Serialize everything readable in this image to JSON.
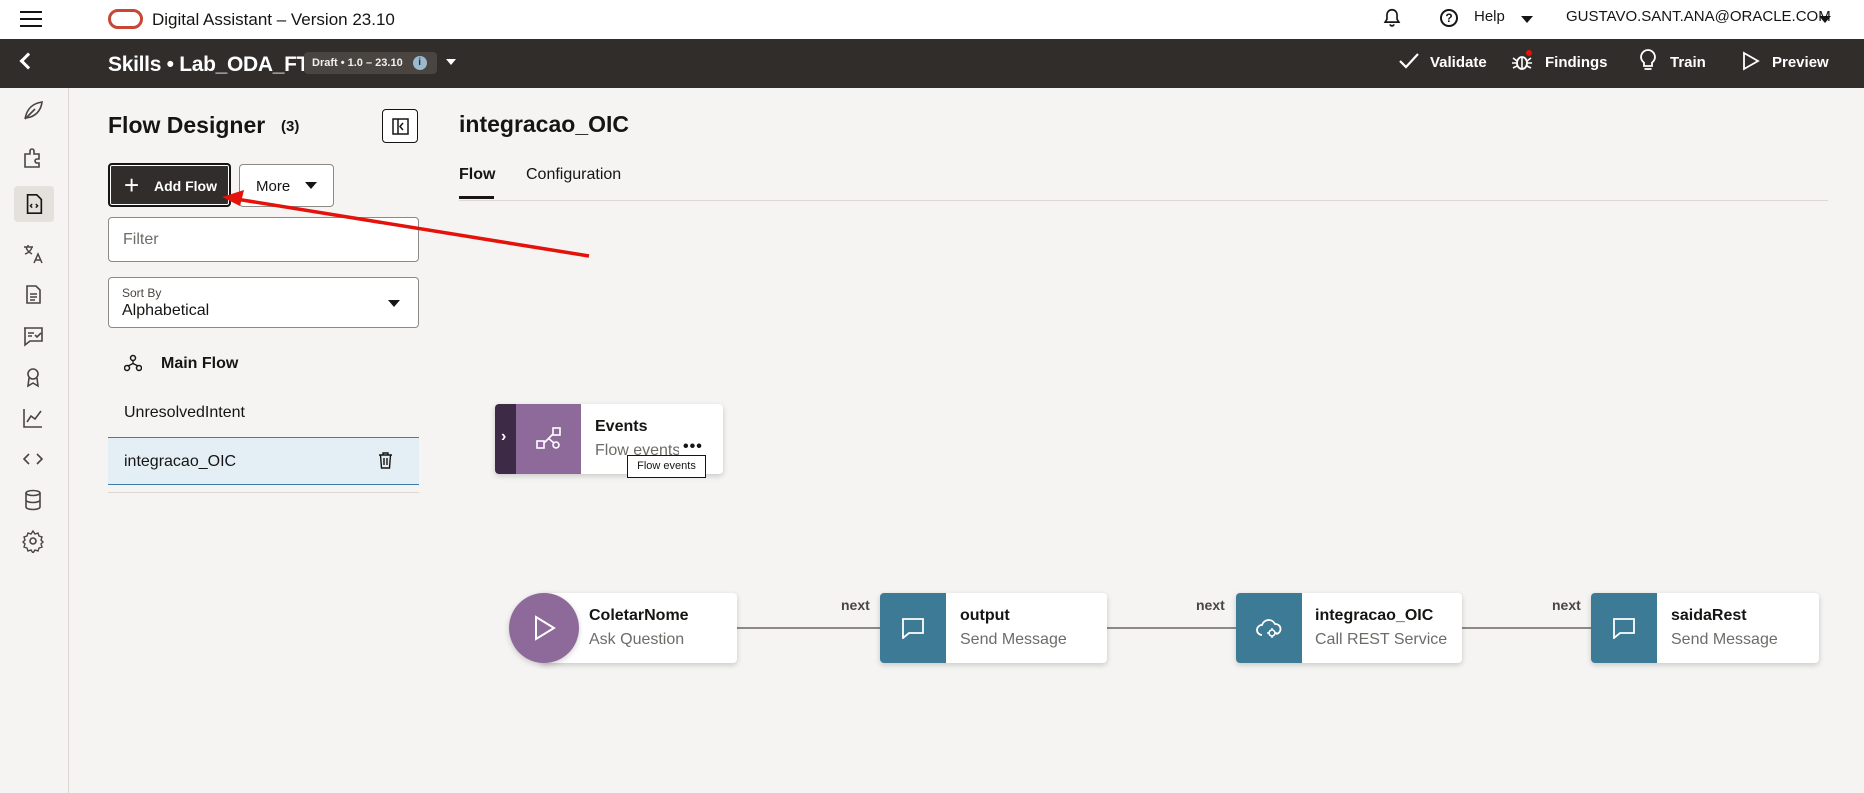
{
  "header": {
    "app_title": "Digital Assistant – Version 23.10",
    "help_label": "Help",
    "user": "GUSTAVO.SANT.ANA@ORACLE.COM"
  },
  "skillbar": {
    "title": "Skills • Lab_ODA_FT",
    "badge": "Draft • 1.0 – 23.10",
    "actions": {
      "validate": "Validate",
      "findings": "Findings",
      "train": "Train",
      "preview": "Preview"
    }
  },
  "panel": {
    "title": "Flow Designer",
    "count": "(3)",
    "add_flow": "Add Flow",
    "more": "More",
    "filter_placeholder": "Filter",
    "sort_label": "Sort By",
    "sort_value": "Alphabetical",
    "flows": [
      "Main Flow",
      "UnresolvedIntent",
      "integracao_OIC"
    ]
  },
  "main": {
    "title": "integracao_OIC",
    "tabs": [
      "Flow",
      "Configuration"
    ],
    "events_node": {
      "title": "Events",
      "sub": "Flow events",
      "tooltip": "Flow events"
    },
    "nodes": [
      {
        "title": "ColetarNome",
        "sub": "Ask Question"
      },
      {
        "title": "output",
        "sub": "Send Message"
      },
      {
        "title": "integracao_OIC",
        "sub": "Call REST Service"
      },
      {
        "title": "saidaRest",
        "sub": "Send Message"
      }
    ],
    "edge_label": "next"
  },
  "colors": {
    "topbar_bg": "#ffffff",
    "skillbar_bg": "#312d2a",
    "node_icon_teal": "#3c7a96",
    "node_icon_purple": "#8e6a9a",
    "annotation_arrow": "#e3120b",
    "oracle_red": "#c74634"
  }
}
